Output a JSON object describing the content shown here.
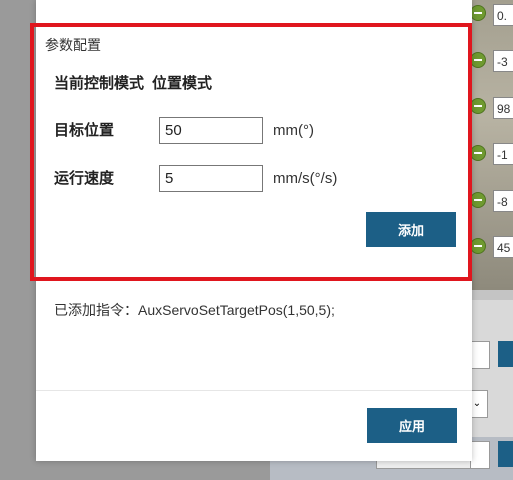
{
  "background": {
    "fields": [
      "0.",
      "-3",
      "98",
      "-1",
      "-8",
      "45"
    ],
    "select_arrow": "⌄"
  },
  "dialog": {
    "section_title": "参数配置",
    "mode": {
      "label": "当前控制模式",
      "value": "位置模式"
    },
    "fields": [
      {
        "label": "目标位置",
        "value": "50",
        "unit": "mm(°)"
      },
      {
        "label": "运行速度",
        "value": "5",
        "unit": "mm/s(°/s)"
      }
    ],
    "add_button": "添加",
    "command": {
      "prefix": "已添加指令：",
      "text": "AuxServoSetTargetPos(1,50,5);"
    },
    "apply_button": "应用"
  },
  "colors": {
    "primary": "#1c5f86",
    "highlight": "#e0161e",
    "knob": "#6f9a30"
  }
}
